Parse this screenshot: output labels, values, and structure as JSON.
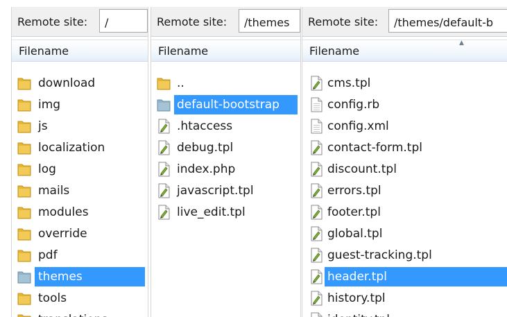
{
  "panes": [
    {
      "remote_label": "Remote site:",
      "path": "/",
      "column_header": "Filename",
      "items": [
        {
          "name": "download",
          "icon": "folder-icon"
        },
        {
          "name": "img",
          "icon": "folder-icon"
        },
        {
          "name": "js",
          "icon": "folder-icon"
        },
        {
          "name": "localization",
          "icon": "folder-icon"
        },
        {
          "name": "log",
          "icon": "folder-icon"
        },
        {
          "name": "mails",
          "icon": "folder-icon"
        },
        {
          "name": "modules",
          "icon": "folder-icon"
        },
        {
          "name": "override",
          "icon": "folder-icon"
        },
        {
          "name": "pdf",
          "icon": "folder-icon"
        },
        {
          "name": "themes",
          "icon": "folder-icon",
          "selected": true
        },
        {
          "name": "tools",
          "icon": "folder-icon"
        },
        {
          "name": "translations",
          "icon": "folder-icon"
        }
      ]
    },
    {
      "remote_label": "Remote site:",
      "path": "/themes",
      "column_header": "Filename",
      "items": [
        {
          "name": "..",
          "icon": "folder-icon"
        },
        {
          "name": "default-bootstrap",
          "icon": "folder-icon",
          "selected": true
        },
        {
          "name": ".htaccess",
          "icon": "file-icon"
        },
        {
          "name": "debug.tpl",
          "icon": "file-icon"
        },
        {
          "name": "index.php",
          "icon": "file-icon"
        },
        {
          "name": "javascript.tpl",
          "icon": "file-icon"
        },
        {
          "name": "live_edit.tpl",
          "icon": "file-icon"
        }
      ]
    },
    {
      "remote_label": "Remote site:",
      "path": "/themes/default-b",
      "column_header": "Filename",
      "items": [
        {
          "name": "cms.tpl",
          "icon": "file-icon"
        },
        {
          "name": "config.rb",
          "icon": "blank-file-icon"
        },
        {
          "name": "config.xml",
          "icon": "blank-file-icon"
        },
        {
          "name": "contact-form.tpl",
          "icon": "file-icon"
        },
        {
          "name": "discount.tpl",
          "icon": "file-icon"
        },
        {
          "name": "errors.tpl",
          "icon": "file-icon"
        },
        {
          "name": "footer.tpl",
          "icon": "file-icon"
        },
        {
          "name": "global.tpl",
          "icon": "file-icon"
        },
        {
          "name": "guest-tracking.tpl",
          "icon": "file-icon"
        },
        {
          "name": "header.tpl",
          "icon": "file-icon",
          "selected": true
        },
        {
          "name": "history.tpl",
          "icon": "file-icon"
        },
        {
          "name": "identity.tpl",
          "icon": "file-icon"
        }
      ]
    }
  ],
  "colors": {
    "selection": "#3399ff",
    "folder": "#e5b533",
    "folder_selected": "#8fb3c9"
  }
}
